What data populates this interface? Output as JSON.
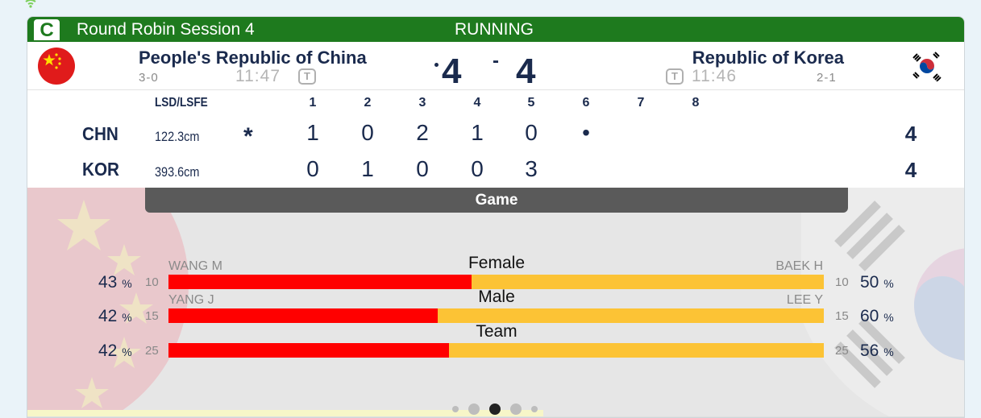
{
  "header": {
    "sheet_letter": "C",
    "session": "Round Robin Session 4",
    "status": "RUNNING"
  },
  "team_left": {
    "name": "People's Republic of China",
    "record": "3-0",
    "clock": "11:47",
    "timeout_icon": "T",
    "score": "4",
    "abbr": "CHN",
    "lsd": "122.3cm",
    "hammer_mark": "*",
    "ends": [
      "1",
      "0",
      "2",
      "1",
      "0",
      "•",
      "",
      ""
    ],
    "total": "4"
  },
  "team_right": {
    "name": "Republic of Korea",
    "record": "2-1",
    "clock": "11:46",
    "timeout_icon": "T",
    "score": "4",
    "abbr": "KOR",
    "lsd": "393.6cm",
    "ends": [
      "0",
      "1",
      "0",
      "0",
      "3",
      "",
      "",
      ""
    ],
    "total": "4"
  },
  "score_separator": "-",
  "ends_header": {
    "lsd_label": "LSD/LSFE",
    "end_numbers": [
      "1",
      "2",
      "3",
      "4",
      "5",
      "6",
      "7",
      "8"
    ]
  },
  "stats": {
    "tab_label": "Game",
    "rows": [
      {
        "label": "Female",
        "left_player": "WANG M",
        "right_player": "BAEK H",
        "left_pct": "43",
        "right_pct": "50",
        "left_shots": "10",
        "right_shots": "10",
        "left_fraction": 0.462
      },
      {
        "label": "Male",
        "left_player": "YANG J",
        "right_player": "LEE Y",
        "left_pct": "42",
        "right_pct": "60",
        "left_shots": "15",
        "right_shots": "15",
        "left_fraction": 0.411
      },
      {
        "label": "Team",
        "left_player": "",
        "right_player": "",
        "left_pct": "42",
        "right_pct": "56",
        "left_shots": "25",
        "right_shots": "25",
        "left_fraction": 0.428
      }
    ],
    "percent_sign": "%"
  },
  "pager": {
    "count": 5,
    "active": 2
  },
  "icons": {
    "wifi": "wifi-icon",
    "flag_left": "china-flag-icon",
    "flag_right": "korea-flag-icon",
    "timeout": "timeout-icon"
  },
  "colors": {
    "header_green": "#1e7a1e",
    "bar_left": "#ff0000",
    "bar_right": "#fcc335",
    "text_navy": "#1a2a4d"
  }
}
